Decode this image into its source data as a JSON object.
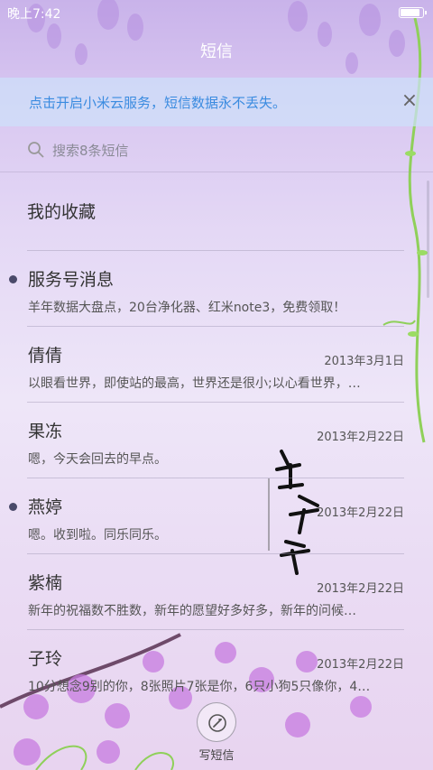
{
  "status": {
    "time": "晚上7:42",
    "battery_level": 0.8
  },
  "header": {
    "title": "短信"
  },
  "banner": {
    "text": "点击开启小米云服务，短信数据永不丢失。",
    "close_icon": "×"
  },
  "search": {
    "placeholder": "搜索8条短信"
  },
  "favorites": {
    "label": "我的收藏"
  },
  "conversations": [
    {
      "name": "服务号消息",
      "date": "",
      "preview": "羊年数据大盘点，20台净化器、红米note3，免费领取！",
      "unread": true
    },
    {
      "name": "倩倩",
      "date": "2013年3月1日",
      "preview": "以眼看世界，即使站的最高，世界还是很小;以心看世界，…",
      "unread": false
    },
    {
      "name": "果冻",
      "date": "2013年2月22日",
      "preview": "嗯，今天会回去的早点。",
      "unread": false
    },
    {
      "name": "燕婷",
      "date": "2013年2月22日",
      "preview": "嗯。收到啦。同乐同乐。",
      "unread": true
    },
    {
      "name": "紫楠",
      "date": "2013年2月22日",
      "preview": "新年的祝福数不胜数，新年的愿望好多好多，新年的问候…",
      "unread": false
    },
    {
      "name": "子玲",
      "date": "2013年2月22日",
      "preview": "10分想念9别的你，8张照片7张是你，6只小狗5只像你，4…",
      "unread": false
    }
  ],
  "compose": {
    "label": "写短信"
  },
  "theme": {
    "accent": "#3a8be0",
    "background": "#e4d8f5"
  },
  "icons": {
    "search": "search-icon",
    "close": "close-icon",
    "compose": "compose-icon",
    "battery": "battery-icon"
  }
}
